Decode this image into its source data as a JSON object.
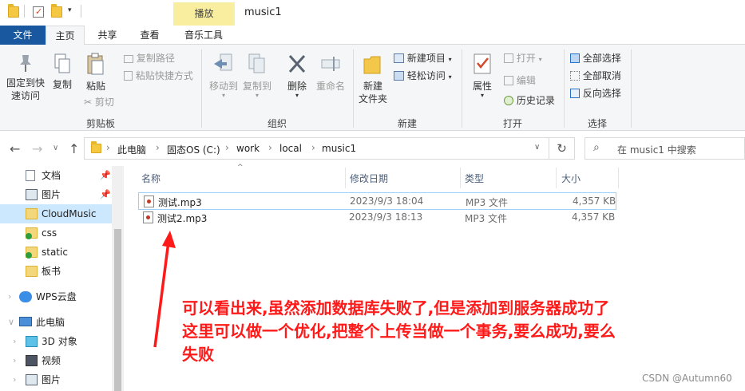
{
  "titlebar": {
    "contextual_tab": "播放",
    "window_title": "music1"
  },
  "tabs": [
    {
      "label": "文件"
    },
    {
      "label": "主页"
    },
    {
      "label": "共享"
    },
    {
      "label": "查看"
    },
    {
      "label": "音乐工具"
    }
  ],
  "ribbon": {
    "clipboard": {
      "pin_label_1": "固定到快",
      "pin_label_2": "速访问",
      "copy": "复制",
      "paste": "粘贴",
      "copy_path": "复制路径",
      "paste_shortcut": "粘贴快捷方式",
      "cut": "剪切",
      "group": "剪贴板"
    },
    "organize": {
      "move_to": "移动到",
      "copy_to": "复制到",
      "delete": "删除",
      "rename": "重命名",
      "group": "组织"
    },
    "new": {
      "new_folder_1": "新建",
      "new_folder_2": "文件夹",
      "new_item": "新建项目",
      "easy_access": "轻松访问",
      "group": "新建"
    },
    "open": {
      "properties": "属性",
      "open": "打开",
      "edit": "编辑",
      "history": "历史记录",
      "group": "打开"
    },
    "select": {
      "select_all": "全部选择",
      "select_none": "全部取消",
      "invert": "反向选择",
      "group": "选择"
    }
  },
  "address": {
    "crumbs": [
      "此电脑",
      "固态OS (C:)",
      "work",
      "local",
      "music1"
    ],
    "search_placeholder": "在 music1 中搜索"
  },
  "nav": {
    "items": [
      {
        "label": "文档",
        "pinned": true
      },
      {
        "label": "图片",
        "pinned": true
      },
      {
        "label": "CloudMusic",
        "selected": true
      },
      {
        "label": "css"
      },
      {
        "label": "static"
      },
      {
        "label": "板书"
      },
      {
        "label": "WPS云盘"
      },
      {
        "label": "此电脑"
      },
      {
        "label": "3D 对象"
      },
      {
        "label": "视频"
      },
      {
        "label": "图片"
      }
    ]
  },
  "columns": [
    "名称",
    "修改日期",
    "类型",
    "大小"
  ],
  "files": [
    {
      "name": "测试.mp3",
      "date": "2023/9/3 18:04",
      "type": "MP3 文件",
      "size": "4,357 KB"
    },
    {
      "name": "测试2.mp3",
      "date": "2023/9/3 18:13",
      "type": "MP3 文件",
      "size": "4,357 KB"
    }
  ],
  "annotation": {
    "line1": "可以看出来,虽然添加数据库失败了,但是添加到服务器成功了",
    "line2": "这里可以做一个优化,把整个上传当做一个事务,要么成功,要么",
    "line3": "失败"
  },
  "watermark": "CSDN @Autumn60",
  "colors": {
    "file_tab": "#19589e",
    "selection": "#cce8ff",
    "contextual": "#f9eea0",
    "annotation": "#ff1a1a"
  }
}
